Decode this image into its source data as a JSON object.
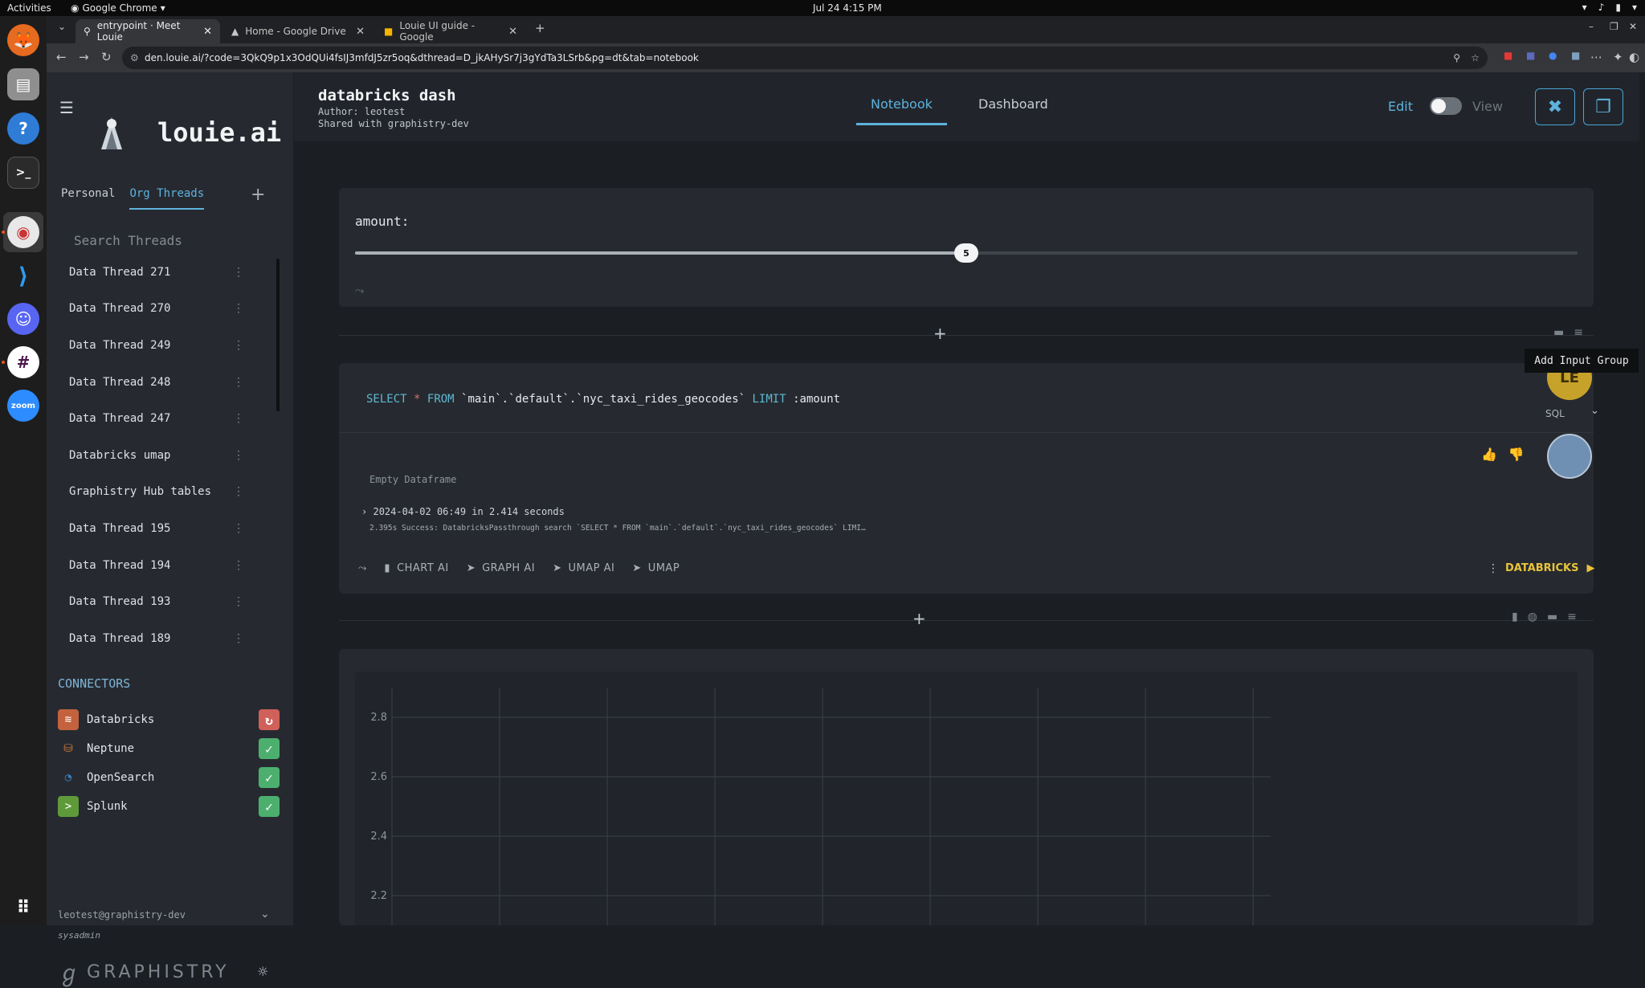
{
  "os": {
    "activities": "Activities",
    "app_name": "Google Chrome",
    "clock": "Jul 24  4:15 PM"
  },
  "browser": {
    "tabs": [
      {
        "title": "entrypoint · Meet Louie",
        "active": true
      },
      {
        "title": "Home - Google Drive",
        "active": false
      },
      {
        "title": "Louie UI guide - Google",
        "active": false
      }
    ],
    "url": "den.louie.ai/?code=3QkQ9p1x3OdQUi4fsIJ3mfdJ5zr5oq&dthread=D_jkAHySr7j3gYdTa3LSrb&pg=dt&tab=notebook"
  },
  "sidebar": {
    "brand": "louie.ai",
    "tabs": [
      "Personal",
      "Org Threads"
    ],
    "active_tab": "Org Threads",
    "search_placeholder": "Search Threads",
    "threads": [
      "Data Thread 271",
      "Data Thread 270",
      "Data Thread 249",
      "Data Thread 248",
      "Data Thread 247",
      "Databricks umap",
      "Graphistry Hub tables",
      "Data Thread 195",
      "Data Thread 194",
      "Data Thread 193",
      "Data Thread 189"
    ],
    "connectors_title": "CONNECTORS",
    "connectors": [
      {
        "name": "Databricks",
        "status": "error"
      },
      {
        "name": "Neptune",
        "status": "ok"
      },
      {
        "name": "OpenSearch",
        "status": "ok"
      },
      {
        "name": "Splunk",
        "status": "ok"
      }
    ],
    "user_email": "leotest@graphistry-dev",
    "user_role": "sysadmin",
    "footer_brand": "GRAPHISTRY"
  },
  "header": {
    "title": "databricks dash",
    "author": "Author: leotest",
    "shared": "Shared with graphistry-dev",
    "view_tabs": [
      "Notebook",
      "Dashboard"
    ],
    "active_view": "Notebook",
    "edit_label": "Edit",
    "view_label": "View"
  },
  "input_cell": {
    "label": "amount:",
    "slider_value": "5",
    "slider_fraction": 0.5
  },
  "sql_cell": {
    "keyword_select": "SELECT",
    "star": "*",
    "keyword_from": "FROM",
    "table": "`main`.`default`.`nyc_taxi_rides_geocodes`",
    "keyword_limit": "LIMIT",
    "param": ":amount",
    "language": "SQL",
    "empty_message": "Empty Dataframe",
    "run_meta": "2024-04-02 06:49 in 2.414 seconds",
    "run_log": "2.395s Success: DatabricksPassthrough search `SELECT * FROM `main`.`default`.`nyc_taxi_rides_geocodes` LIMI…",
    "actions": [
      "CHART AI",
      "GRAPH AI",
      "UMAP AI",
      "UMAP"
    ],
    "run_label": "DATABRICKS"
  },
  "avatars": {
    "user_initials": "LE"
  },
  "tooltip": "Add Input Group",
  "chart_data": {
    "type": "line",
    "title": "",
    "xlabel": "",
    "ylabel": "",
    "y_ticks": [
      "2.8",
      "2.6",
      "2.4",
      "2.2"
    ],
    "ylim": [
      2.1,
      2.9
    ],
    "grid": true,
    "series": []
  }
}
